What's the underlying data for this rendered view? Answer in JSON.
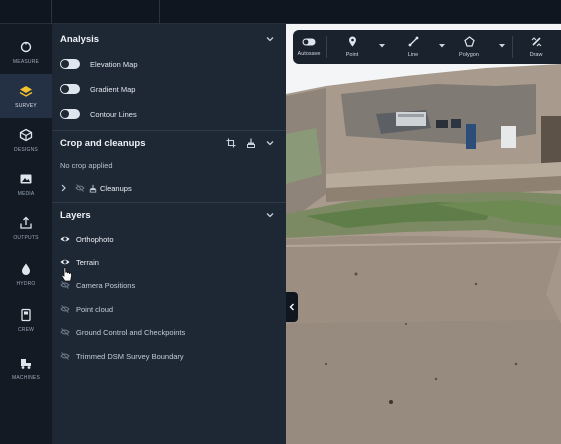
{
  "rail": {
    "items": [
      {
        "label": "MEASURE",
        "icon": "measure-icon"
      },
      {
        "label": "SURVEY",
        "icon": "survey-layers-icon"
      },
      {
        "label": "DESIGNS",
        "icon": "designs-icon"
      },
      {
        "label": "MEDIA",
        "icon": "media-icon"
      },
      {
        "label": "OUTPUTS",
        "icon": "outputs-icon"
      },
      {
        "label": "HYDRO",
        "icon": "hydro-drop-icon"
      },
      {
        "label": "CREW",
        "icon": "crew-icon"
      },
      {
        "label": "MACHINES",
        "icon": "machines-icon"
      }
    ],
    "active": "SURVEY"
  },
  "analysis": {
    "title": "Analysis",
    "toggles": [
      "Elevation Map",
      "Gradient Map",
      "Contour Lines"
    ]
  },
  "crop": {
    "title": "Crop and cleanups",
    "status": "No crop applied",
    "cleanups_label": "Cleanups"
  },
  "layers": {
    "title": "Layers",
    "items": [
      {
        "label": "Orthophoto",
        "visible": true
      },
      {
        "label": "Terrain",
        "visible": true
      },
      {
        "label": "Camera Positions",
        "visible": false
      },
      {
        "label": "Point cloud",
        "visible": false
      },
      {
        "label": "Ground Control and Checkpoints",
        "visible": false
      },
      {
        "label": "Trimmed DSM Survey Boundary",
        "visible": false
      }
    ]
  },
  "toolbar": {
    "autosave": "Autosave",
    "point": "Point",
    "line": "Line",
    "polygon": "Polygon",
    "draw": "Draw"
  },
  "colors": {
    "panel": "#1e2734",
    "rail": "#131a24",
    "active": "#243044",
    "accent": "#f2c12e"
  }
}
